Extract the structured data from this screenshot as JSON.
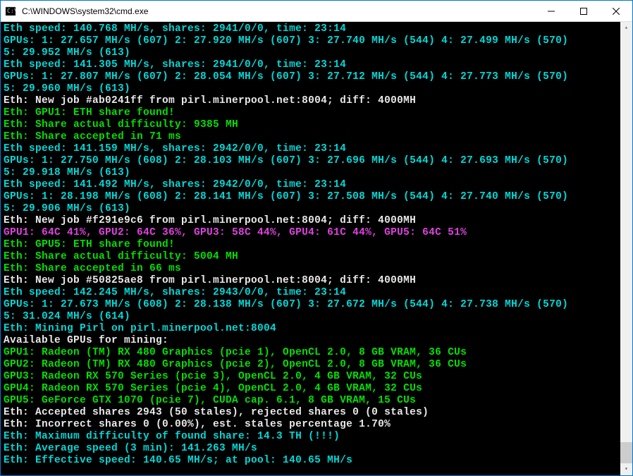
{
  "window": {
    "title": "C:\\WINDOWS\\system32\\cmd.exe"
  },
  "lines": [
    {
      "c": "c-cyan",
      "t": "Eth speed: 140.768 MH/s, shares: 2941/0/0, time: 23:14"
    },
    {
      "c": "c-cyan",
      "t": "GPUs: 1: 27.657 MH/s (607) 2: 27.920 MH/s (607) 3: 27.740 MH/s (544) 4: 27.499 MH/s (570) 5: 29.952 MH/s (613)"
    },
    {
      "c": "c-cyan",
      "t": "Eth speed: 141.305 MH/s, shares: 2941/0/0, time: 23:14"
    },
    {
      "c": "c-cyan",
      "t": "GPUs: 1: 27.807 MH/s (607) 2: 28.054 MH/s (607) 3: 27.712 MH/s (544) 4: 27.773 MH/s (570) 5: 29.960 MH/s (613)"
    },
    {
      "c": "c-white",
      "t": "Eth: New job #ab0241ff from pirl.minerpool.net:8004; diff: 4000MH"
    },
    {
      "c": "c-green",
      "t": "Eth: GPU1: ETH share found!"
    },
    {
      "c": "c-green",
      "t": "Eth: Share actual difficulty: 9385 MH"
    },
    {
      "c": "c-green",
      "t": "Eth: Share accepted in 71 ms"
    },
    {
      "c": "c-cyan",
      "t": "Eth speed: 141.159 MH/s, shares: 2942/0/0, time: 23:14"
    },
    {
      "c": "c-cyan",
      "t": "GPUs: 1: 27.750 MH/s (608) 2: 28.103 MH/s (607) 3: 27.696 MH/s (544) 4: 27.693 MH/s (570) 5: 29.918 MH/s (613)"
    },
    {
      "c": "c-cyan",
      "t": "Eth speed: 141.492 MH/s, shares: 2942/0/0, time: 23:14"
    },
    {
      "c": "c-cyan",
      "t": "GPUs: 1: 28.198 MH/s (608) 2: 28.141 MH/s (607) 3: 27.508 MH/s (544) 4: 27.740 MH/s (570) 5: 29.906 MH/s (613)"
    },
    {
      "c": "c-white",
      "t": "Eth: New job #f291e9c6 from pirl.minerpool.net:8004; diff: 4000MH"
    },
    {
      "c": "c-magenta",
      "t": "GPU1: 64C 41%, GPU2: 64C 36%, GPU3: 58C 44%, GPU4: 61C 44%, GPU5: 64C 51%"
    },
    {
      "c": "c-green",
      "t": "Eth: GPU5: ETH share found!"
    },
    {
      "c": "c-green",
      "t": "Eth: Share actual difficulty: 5004 MH"
    },
    {
      "c": "c-green",
      "t": "Eth: Share accepted in 66 ms"
    },
    {
      "c": "c-white",
      "t": "Eth: New job #50825ae8 from pirl.minerpool.net:8004; diff: 4000MH"
    },
    {
      "c": "c-cyan",
      "t": "Eth speed: 142.245 MH/s, shares: 2943/0/0, time: 23:14"
    },
    {
      "c": "c-cyan",
      "t": "GPUs: 1: 27.673 MH/s (608) 2: 28.138 MH/s (607) 3: 27.672 MH/s (544) 4: 27.738 MH/s (570) 5: 31.024 MH/s (614)"
    },
    {
      "c": "c-cyan",
      "t": ""
    },
    {
      "c": "c-cyan",
      "t": "Eth: Mining Pirl on pirl.minerpool.net:8004"
    },
    {
      "c": "c-white",
      "t": "Available GPUs for mining:"
    },
    {
      "c": "c-green",
      "t": "GPU1: Radeon (TM) RX 480 Graphics (pcie 1), OpenCL 2.0, 8 GB VRAM, 36 CUs"
    },
    {
      "c": "c-green",
      "t": "GPU2: Radeon (TM) RX 480 Graphics (pcie 2), OpenCL 2.0, 8 GB VRAM, 36 CUs"
    },
    {
      "c": "c-green",
      "t": "GPU3: Radeon RX 570 Series (pcie 3), OpenCL 2.0, 4 GB VRAM, 32 CUs"
    },
    {
      "c": "c-green",
      "t": "GPU4: Radeon RX 570 Series (pcie 4), OpenCL 2.0, 4 GB VRAM, 32 CUs"
    },
    {
      "c": "c-green",
      "t": "GPU5: GeForce GTX 1070 (pcie 7), CUDA cap. 6.1, 8 GB VRAM, 15 CUs"
    },
    {
      "c": "c-white",
      "t": "Eth: Accepted shares 2943 (50 stales), rejected shares 0 (0 stales)"
    },
    {
      "c": "c-white",
      "t": "Eth: Incorrect shares 0 (0.00%), est. stales percentage 1.70%"
    },
    {
      "c": "c-cyan",
      "t": "Eth: Maximum difficulty of found share: 14.3 TH (!!!)"
    },
    {
      "c": "c-cyan",
      "t": "Eth: Average speed (3 min): 141.263 MH/s"
    },
    {
      "c": "c-cyan",
      "t": "Eth: Effective speed: 140.65 MH/s; at pool: 140.65 MH/s"
    }
  ]
}
